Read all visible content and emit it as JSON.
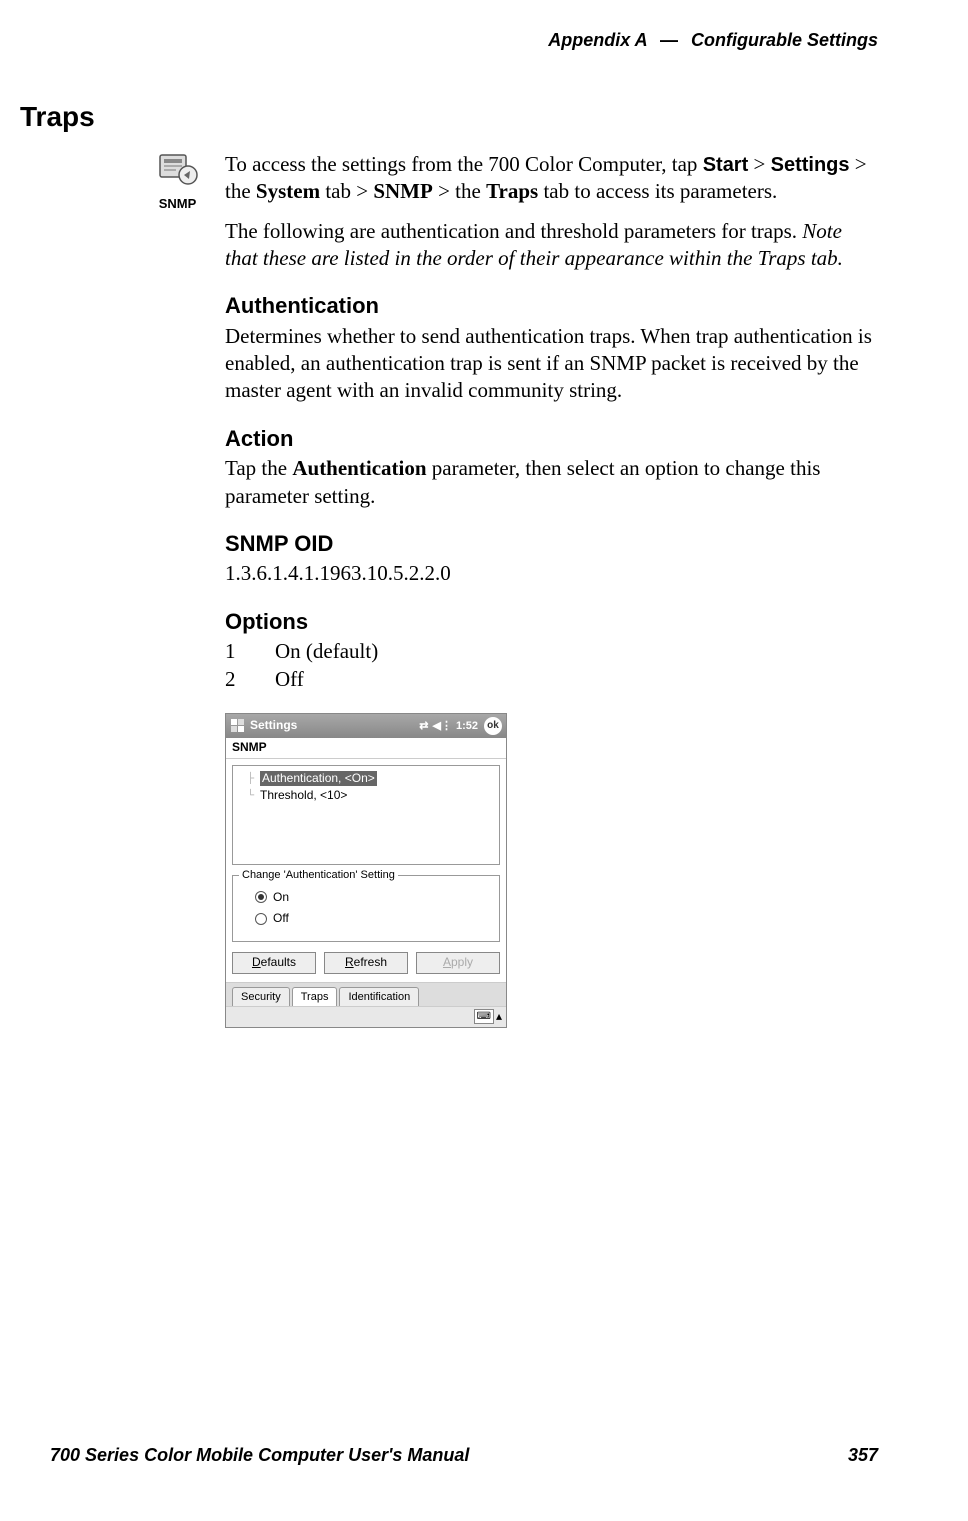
{
  "header": {
    "appendix": "Appendix A",
    "separator": "—",
    "section": "Configurable Settings"
  },
  "section_title": "Traps",
  "icon": {
    "label": "SNMP"
  },
  "intro": {
    "line1_pre": "To access the settings from the 700 Color Computer, tap ",
    "start_bold": "Start",
    "gt1": " > ",
    "settings_bold": "Settings",
    "gt2": " > the ",
    "system_bold": "System",
    "mid1": " tab > ",
    "snmp_bold": "SNMP",
    "gt3": " > the ",
    "traps_bold": "Traps",
    "line1_post": " tab to access its parameters.",
    "line2_pre": "The following are authentication and threshold parameters for traps. ",
    "line2_italic": "Note that these are listed in the order of their appearance within the Traps tab."
  },
  "auth": {
    "heading": "Authentication",
    "body": "Determines whether to send authentication traps. When trap authentication is enabled, an authentication trap is sent if an SNMP packet is received by the master agent with an invalid community string."
  },
  "action": {
    "heading": "Action",
    "pre": "Tap the ",
    "bold": "Authentication",
    "post": " parameter, then select an option to change this parameter setting."
  },
  "oid": {
    "heading": "SNMP OID",
    "value": "1.3.6.1.4.1.1963.10.5.2.2.0"
  },
  "options": {
    "heading": "Options",
    "rows": [
      {
        "num": "1",
        "text": "On (default)"
      },
      {
        "num": "2",
        "text": "Off"
      }
    ]
  },
  "device": {
    "title": "Settings",
    "time": "1:52",
    "ok": "ok",
    "app_title": "SNMP",
    "tree": [
      {
        "text": "Authentication, <On>",
        "selected": true
      },
      {
        "text": "Threshold, <10>",
        "selected": false
      }
    ],
    "group_legend": "Change 'Authentication' Setting",
    "radios": [
      {
        "label": "On",
        "checked": true
      },
      {
        "label": "Off",
        "checked": false
      }
    ],
    "buttons": {
      "defaults_u": "D",
      "defaults_rest": "efaults",
      "refresh_u": "R",
      "refresh_rest": "efresh",
      "apply_u": "A",
      "apply_rest": "pply"
    },
    "tabs": [
      {
        "label": "Security",
        "active": false
      },
      {
        "label": "Traps",
        "active": true
      },
      {
        "label": "Identification",
        "active": false
      }
    ]
  },
  "footer": {
    "left": "700 Series Color Mobile Computer User's Manual",
    "right": "357"
  }
}
